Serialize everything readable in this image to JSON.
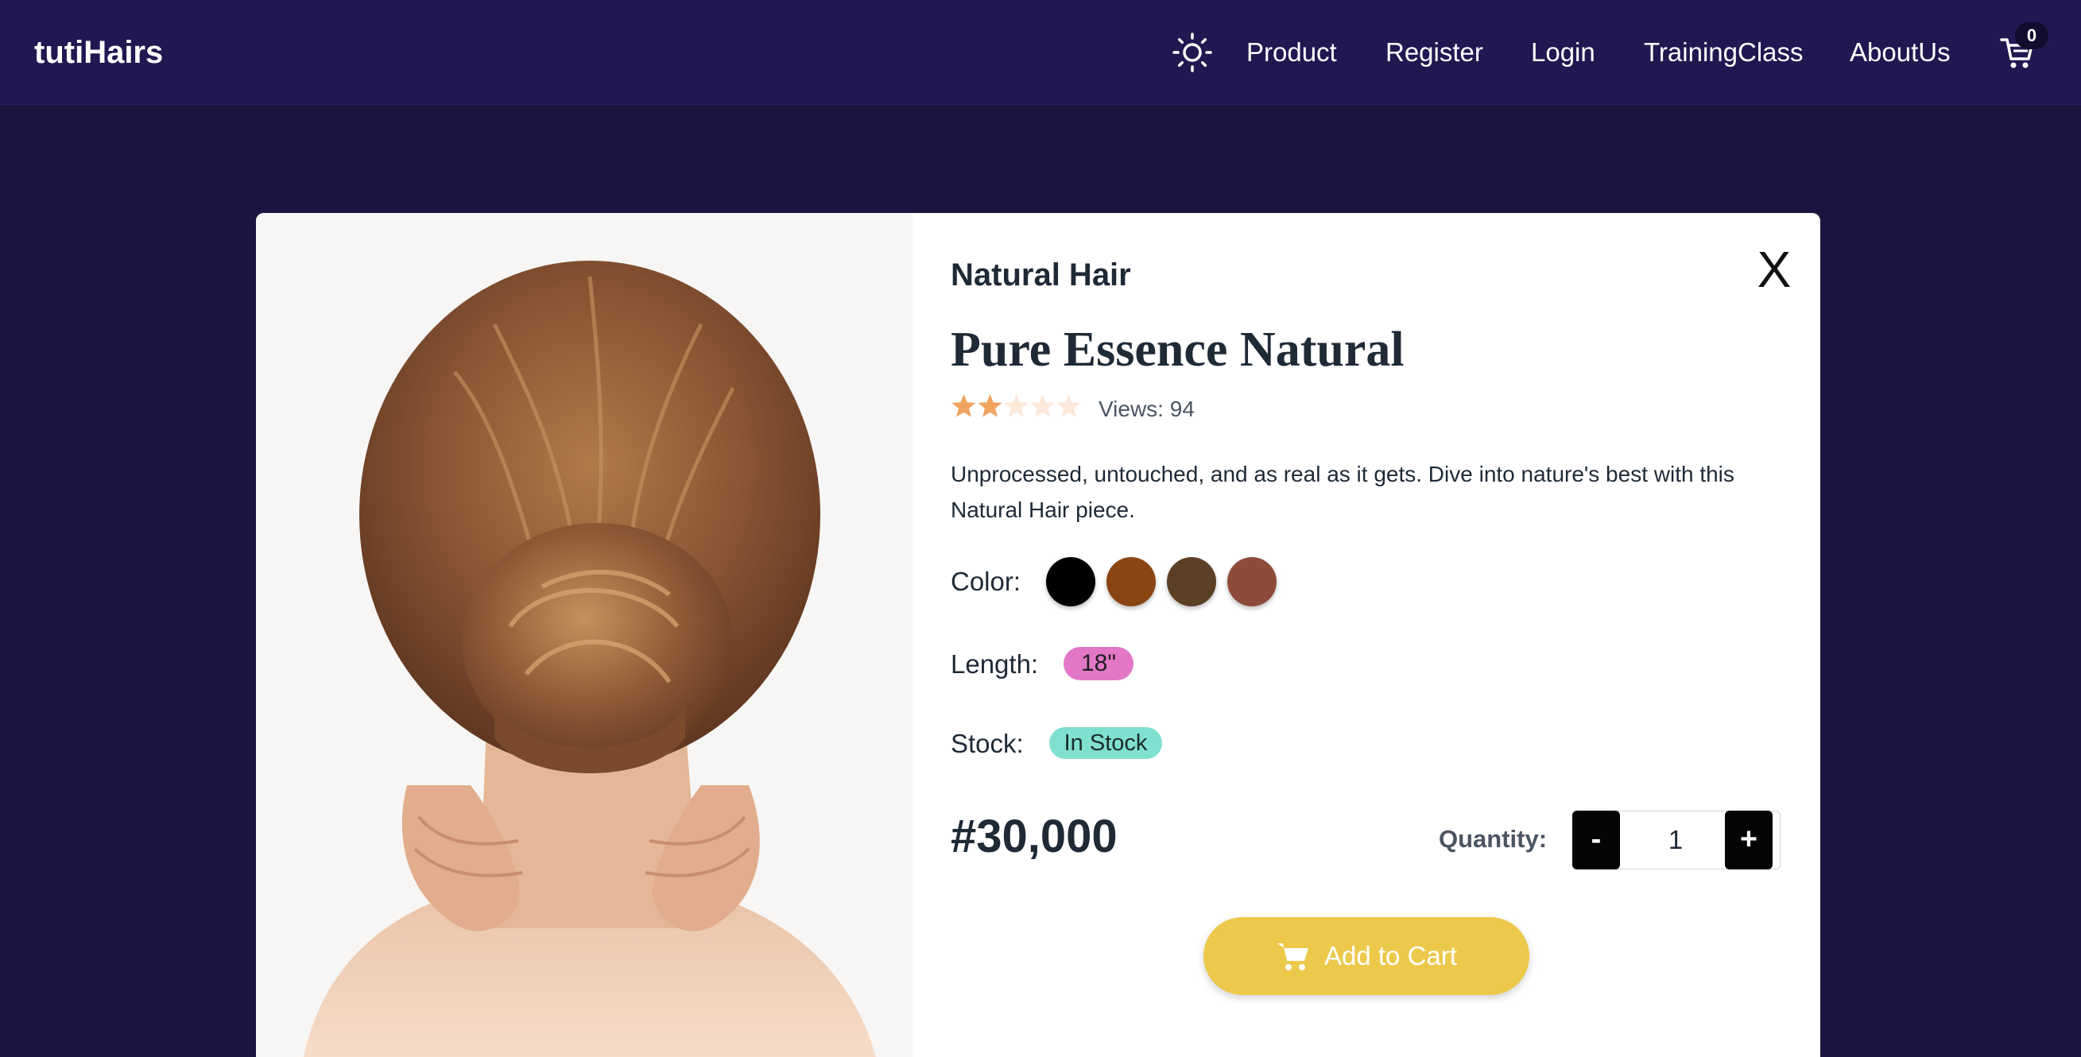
{
  "navbar": {
    "brand": "tutiHairs",
    "theme_icon": "sun-icon",
    "links": [
      "Product",
      "Register",
      "Login",
      "TrainingClass",
      "AboutUs"
    ],
    "cart_icon": "cart-icon",
    "cart_count": "0"
  },
  "modal": {
    "image_subject": "woman-low-bun-back-view",
    "category": "Natural Hair",
    "close_label": "X",
    "title": "Pure Essence Natural",
    "rating": {
      "value": 2,
      "max": 5
    },
    "views_label": "Views:",
    "views_count": "94",
    "description": "Unprocessed, untouched, and as real as it gets. Dive into nature's best with this Natural Hair piece.",
    "color_label": "Color:",
    "colors": [
      "#000000",
      "#8b4513",
      "#5c4026",
      "#8e4b3b"
    ],
    "length_label": "Length:",
    "length_value": "18\"",
    "stock_label": "Stock:",
    "stock_value": "In Stock",
    "price": "#30,000",
    "quantity_label": "Quantity:",
    "quantity_minus": "-",
    "quantity_value": "1",
    "quantity_plus": "+",
    "add_to_cart_label": "Add to Cart"
  },
  "theme": {
    "page_bg": "#1b1340",
    "navbar_bg": "#201851",
    "star_filled": "#f0a35e",
    "star_empty": "#fde8dc",
    "add_to_cart_bg": "#ecc94b",
    "length_chip_bg": "#e177c6",
    "stock_badge_bg": "#7fe0cf"
  }
}
